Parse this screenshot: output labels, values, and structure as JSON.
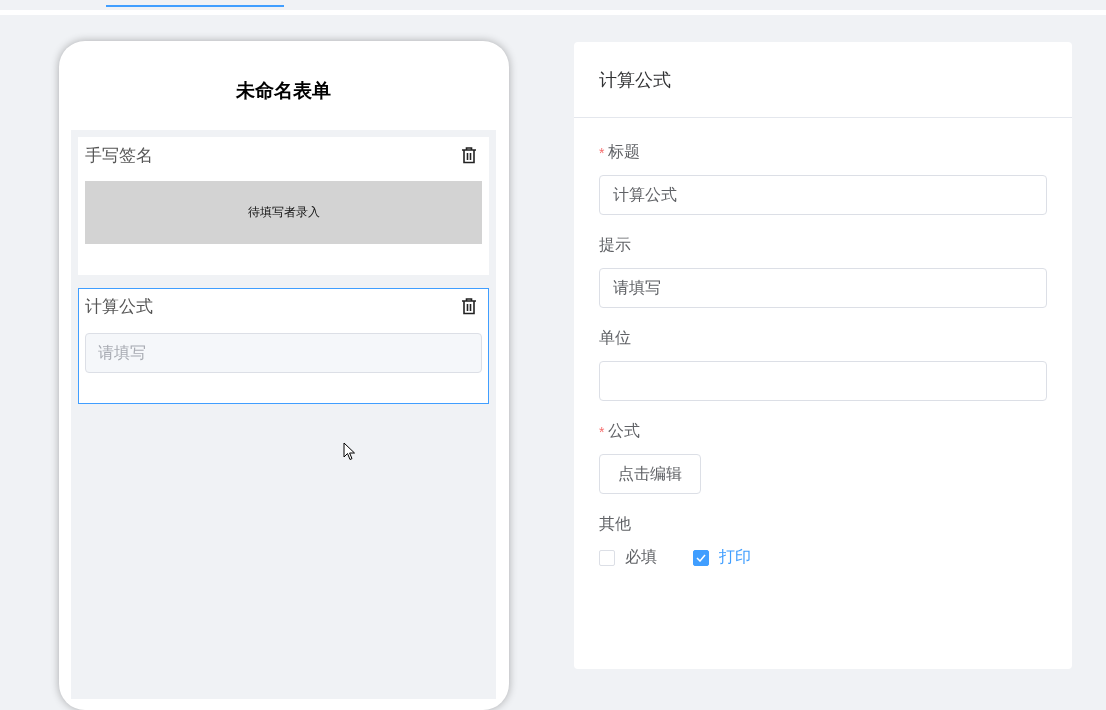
{
  "form": {
    "title": "未命名表单",
    "items": [
      {
        "kind": "signature",
        "label": "手写签名",
        "selected": false,
        "box_text": "待填写者录入"
      },
      {
        "kind": "input",
        "label": "计算公式",
        "selected": true,
        "placeholder": "请填写"
      }
    ]
  },
  "panel": {
    "title": "计算公式",
    "fields": [
      {
        "kind": "input",
        "label": "标题",
        "required_mark": "*",
        "value": "计算公式"
      },
      {
        "kind": "input",
        "label": "提示",
        "value": "请填写"
      },
      {
        "kind": "input",
        "label": "单位"
      },
      {
        "kind": "button",
        "label": "公式",
        "required_mark": "*",
        "button": "点击编辑"
      },
      {
        "kind": "checkboxes",
        "label": "其他",
        "options": [
          {
            "label": "必填",
            "checked": false
          },
          {
            "label": "打印",
            "checked": true
          }
        ]
      }
    ]
  }
}
